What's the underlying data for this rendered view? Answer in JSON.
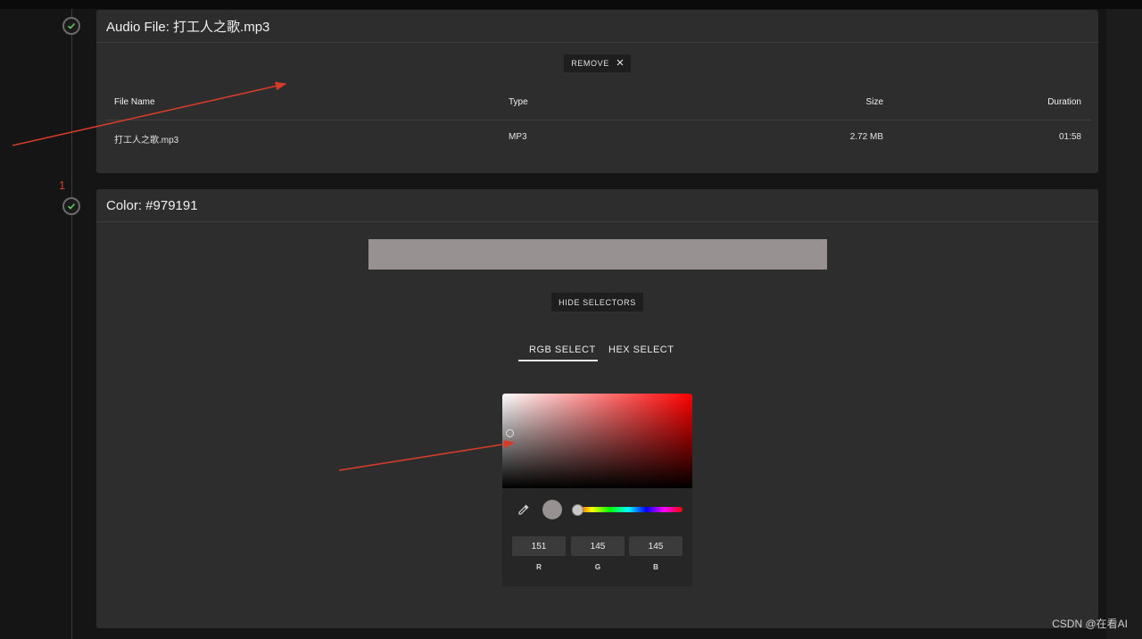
{
  "steps": {
    "annotation_number": "1"
  },
  "audio_panel": {
    "title": "Audio File: 打工人之歌.mp3",
    "remove_label": "REMOVE",
    "columns": [
      "File Name",
      "Type",
      "Size",
      "Duration"
    ],
    "row": {
      "file_name": "打工人之歌.mp3",
      "type": "MP3",
      "size": "2.72 MB",
      "duration": "01:58"
    }
  },
  "color_panel": {
    "title": "Color: #979191",
    "swatch_color": "#979191",
    "hide_selectors_label": "HIDE SELECTORS",
    "tabs": [
      {
        "label": "RGB SELECT",
        "active": true
      },
      {
        "label": "HEX SELECT",
        "active": false
      }
    ],
    "picker": {
      "hue_color": "#ff0000",
      "rgb": {
        "r": "151",
        "g": "145",
        "b": "145"
      },
      "labels": {
        "r": "R",
        "g": "G",
        "b": "B"
      }
    }
  },
  "colors": {
    "background": "#151515",
    "panel": "#2d2d2d",
    "check": "#5cd05c",
    "annotation_red": "#d43b2a"
  },
  "watermark": "CSDN @在看AI"
}
